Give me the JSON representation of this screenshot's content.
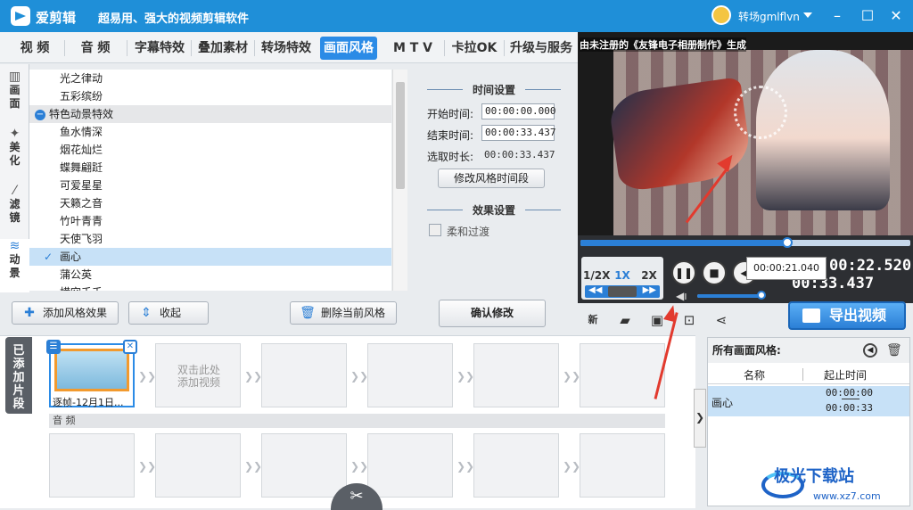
{
  "app": {
    "name": "爱剪辑",
    "slogan": "超易用、强大的视频剪辑软件",
    "user": "转场gmlflvn"
  },
  "tabs": [
    "视 频",
    "音 频",
    "字幕特效",
    "叠加素材",
    "转场特效",
    "画面风格",
    "M T V",
    "卡拉OK",
    "升级与服务"
  ],
  "active_tab": "画面风格",
  "side_tabs": [
    {
      "label": "画\n面",
      "icon": "film-icon"
    },
    {
      "label": "美\n化",
      "icon": "magic-icon"
    },
    {
      "label": "滤\n镜",
      "icon": "wand-icon"
    },
    {
      "label": "动\n景",
      "icon": "wave-icon"
    }
  ],
  "effects": {
    "items": [
      {
        "label": "光之律动",
        "type": "item"
      },
      {
        "label": "五彩缤纷",
        "type": "item"
      },
      {
        "label": "特色动景特效",
        "type": "category"
      },
      {
        "label": "鱼水情深",
        "type": "item"
      },
      {
        "label": "烟花灿烂",
        "type": "item"
      },
      {
        "label": "蝶舞翩跹",
        "type": "item"
      },
      {
        "label": "可爱星星",
        "type": "item"
      },
      {
        "label": "天籁之音",
        "type": "item"
      },
      {
        "label": "竹叶青青",
        "type": "item"
      },
      {
        "label": "天使飞羽",
        "type": "item"
      },
      {
        "label": "画心",
        "type": "selected"
      },
      {
        "label": "蒲公英",
        "type": "item"
      },
      {
        "label": "横空千千",
        "type": "item"
      }
    ]
  },
  "settings": {
    "time_header": "时间设置",
    "start_label": "开始时间:",
    "start_value": "00:00:00.000",
    "end_label": "结束时间:",
    "end_value": "00:00:33.437",
    "duration_label": "选取时长:",
    "duration_value": "00:00:33.437",
    "modify_time_button": "修改风格时间段",
    "effect_header": "效果设置",
    "soft_transition": "柔和过渡",
    "confirm_button": "确认修改"
  },
  "toolbar": {
    "add_label": "添加风格效果",
    "collapse_label": "收起",
    "delete_label": "删除当前风格"
  },
  "preview": {
    "watermark": "由未注册的《友锋电子相册制作》生成",
    "progress": 0.6279,
    "current_time": "00:22.520",
    "total_time": "00:33.437",
    "tooltip_time": "00:00:21.040",
    "volume": 0.95,
    "speeds": [
      "1/2X",
      "1X",
      "2X"
    ],
    "active_speed": "1X"
  },
  "actions": {
    "icons": [
      "new-icon",
      "folder-icon",
      "save-icon",
      "saveas-icon",
      "share-icon"
    ],
    "new_label": "新",
    "export_label": "导出视频"
  },
  "timeline": {
    "added_label": "已添加片段",
    "clip_name": "逐帧-12月1日...",
    "empty_slot": "双击此处\n添加视频",
    "audio_label": "音 频"
  },
  "style_list": {
    "title": "所有画面风格:",
    "col_name": "名称",
    "col_time": "起止时间",
    "row_name": "画心",
    "row_start": "00:00:00",
    "row_end": "00:00:33"
  },
  "watermark_site": {
    "name": "极光下载站",
    "url": "www.xz7.com"
  },
  "colors": {
    "accent": "#2b8be6",
    "titlebar": "#1f8fd8",
    "selection": "#c7e1f7",
    "annotation": "#e23a2e"
  }
}
